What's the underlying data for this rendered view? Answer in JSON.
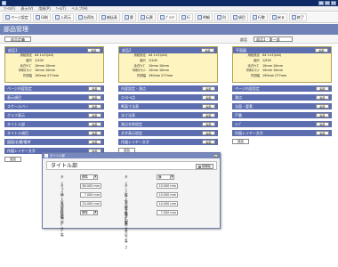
{
  "window": {
    "title": "",
    "controls": [
      "_",
      "□",
      "✕"
    ]
  },
  "menu": [
    "ﾌｧｲﾙ(F)",
    "表示(V)",
    "用紙(P)",
    "ﾂｰﾙ(T)",
    "ヘルプ(H)"
  ],
  "toolbar": [
    {
      "label": "ページ設定",
      "icon": "page-setup-icon"
    },
    {
      "label": "印刷",
      "icon": "print-icon"
    },
    {
      "label": "入荷元",
      "icon": "supplier-icon"
    },
    {
      "label": "出荷先",
      "icon": "ship-icon"
    },
    {
      "label": "総括表",
      "icon": "summary-icon"
    },
    {
      "label": "票",
      "icon": "slip-icon"
    },
    {
      "label": "伝票",
      "icon": "voucher-icon"
    },
    {
      "label": "ﾌﾞﾗﾝｸ",
      "icon": "blank-icon"
    },
    {
      "label": "行",
      "icon": "row-icon"
    },
    {
      "label": "明細",
      "icon": "detail-icon"
    },
    {
      "label": "列",
      "icon": "column-icon"
    },
    {
      "label": "項目",
      "icon": "item-icon"
    },
    {
      "label": "行数",
      "icon": "rowcount-icon"
    },
    {
      "label": "戻る",
      "icon": "back-icon"
    },
    {
      "label": "終了",
      "icon": "exit-icon"
    }
  ],
  "page": {
    "title": "部品管理",
    "back_label": "部品定義",
    "display_label": "部品",
    "display_value": "部品1 - 第一部"
  },
  "columns": [
    {
      "spec_title": "部品1",
      "edit": "編集",
      "specs": [
        {
          "k": "用紙設定",
          "v": "A4 1×ﾖｺ(A4)"
        },
        {
          "k": "縮尺",
          "v": "1/100"
        },
        {
          "k": "余白ｻｲｽﾞ",
          "v": "10mm 10mm"
        },
        {
          "k": "印刷ｵﾌｾｯﾄ",
          "v": "10mm 10mm"
        },
        {
          "k": "作図幅",
          "v": "190mm 277mm"
        }
      ],
      "bars": [
        "ページ内容設定",
        "表示項目",
        "スケールバー",
        "グラフ表示",
        "タイトル部",
        "タイトル項目",
        "図面/右欄/備考",
        "作図レイヤー文字"
      ],
      "add": "追加"
    },
    {
      "spec_title": "部品2",
      "edit": "編集",
      "specs": [
        {
          "k": "用紙設定",
          "v": "A4 1×ﾖｺ(A4)"
        },
        {
          "k": "縮尺",
          "v": "1/100"
        },
        {
          "k": "余白ｻｲｽﾞ",
          "v": "10mm 10mm"
        },
        {
          "k": "印刷ｵﾌｾｯﾄ",
          "v": "10mm 10mm"
        },
        {
          "k": "作図幅",
          "v": "190mm 277mm"
        }
      ],
      "bars": [
        "内容設定・測点",
        "ｺﾝﾄﾛｰﾙ点",
        "断面寸法表",
        "法寸法表",
        "測点名称設定",
        "文字表示設定",
        "作図レイヤー文字"
      ],
      "add": "追加"
    },
    {
      "spec_title": "平面図",
      "edit": "編集",
      "specs": [
        {
          "k": "用紙設定",
          "v": "A4 1×ﾖｺ(A4)"
        },
        {
          "k": "縮尺",
          "v": "1/500"
        },
        {
          "k": "余白ｻｲｽﾞ",
          "v": "10mm 10mm"
        },
        {
          "k": "印刷ｵﾌｾｯﾄ",
          "v": "10mm 10mm"
        },
        {
          "k": "作図幅",
          "v": "190mm 277mm"
        }
      ],
      "bars": [
        "ページ内容設定",
        "測点",
        "法面・要素",
        "戸番",
        "ﾗﾝﾌﾟ",
        "作図レイヤー文字"
      ],
      "add": "追加"
    }
  ],
  "dialog": {
    "window_title": "タイトル部",
    "heading": "タイトル部",
    "reload_label": "初期化",
    "close": "✕",
    "fields": [
      {
        "label": "タイプ",
        "value": "標準",
        "kind": "select"
      },
      {
        "label": "タイトル文字方向",
        "value": "横",
        "kind": "select"
      },
      {
        "label": "タイトル枠幅",
        "value": "80.000 mm",
        "kind": "input"
      },
      {
        "label": "タイトル文字高",
        "value": "10.000 mm",
        "kind": "input"
      },
      {
        "label": "横の線幅",
        "value": "7.000 mm",
        "kind": "input"
      },
      {
        "label": "縦の線幅",
        "value": "10.000 mm",
        "kind": "input"
      },
      {
        "label": "長方形部分高",
        "value": "20.000 mm",
        "kind": "input"
      },
      {
        "label": "グラフ部分の高さ",
        "value": "10.000 mm",
        "kind": "input"
      },
      {
        "label": "ﾋﾞｸﾀｲﾌﾟ",
        "value": "標準",
        "kind": "select"
      },
      {
        "label": "ﾋﾞｸの長さ",
        "value": "7.000 mm",
        "kind": "input"
      }
    ]
  }
}
